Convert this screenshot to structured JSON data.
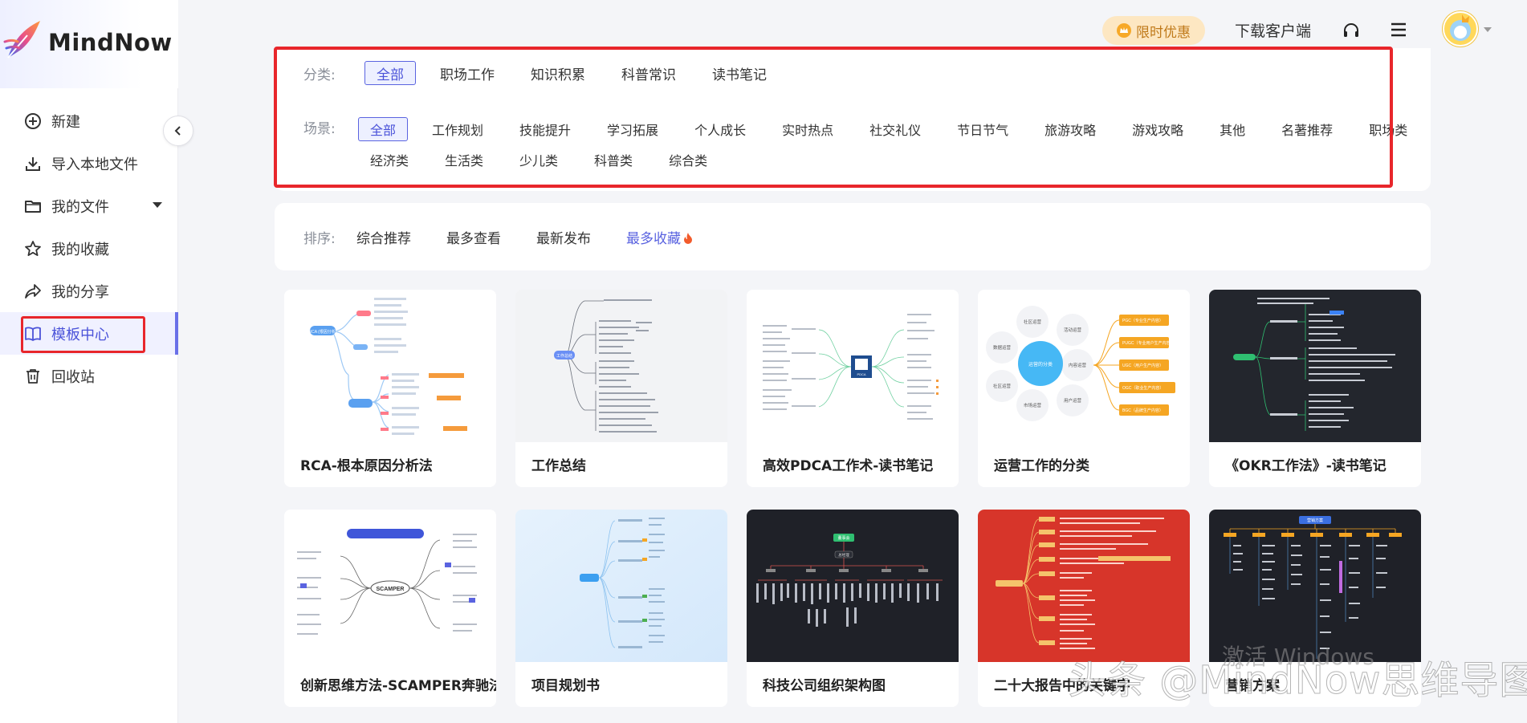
{
  "brand": {
    "name": "MindNow"
  },
  "sidebar": {
    "items": [
      {
        "label": "新建",
        "icon": "plus-circle-icon"
      },
      {
        "label": "导入本地文件",
        "icon": "import-icon"
      },
      {
        "label": "我的文件",
        "icon": "folder-icon"
      },
      {
        "label": "我的收藏",
        "icon": "star-icon"
      },
      {
        "label": "我的分享",
        "icon": "share-icon"
      },
      {
        "label": "模板中心",
        "icon": "book-icon",
        "active": true
      },
      {
        "label": "回收站",
        "icon": "trash-icon"
      }
    ]
  },
  "header": {
    "promo": "限时优惠",
    "download": "下载客户端"
  },
  "filters": {
    "category_label": "分类:",
    "categories": [
      "全部",
      "职场工作",
      "知识积累",
      "科普常识",
      "读书笔记"
    ],
    "category_selected": "全部",
    "scene_label": "场景:",
    "scenes": [
      "全部",
      "工作规划",
      "技能提升",
      "学习拓展",
      "个人成长",
      "实时热点",
      "社交礼仪",
      "节日节气",
      "旅游攻略",
      "游戏攻略",
      "其他",
      "名著推荐",
      "职场类",
      "经济类",
      "生活类",
      "少儿类",
      "科普类",
      "综合类"
    ],
    "scene_selected": "全部"
  },
  "sort": {
    "label": "排序:",
    "options": [
      "综合推荐",
      "最多查看",
      "最新发布",
      "最多收藏"
    ],
    "selected": "最多收藏"
  },
  "templates": [
    {
      "title": "RCA-根本原因分析法",
      "theme": "light"
    },
    {
      "title": "工作总结",
      "theme": "gray"
    },
    {
      "title": "高效PDCA工作术-读书笔记",
      "theme": "light"
    },
    {
      "title": "运营工作的分类",
      "theme": "light"
    },
    {
      "title": "《OKR工作法》-读书笔记",
      "theme": "dark"
    },
    {
      "title": "创新思维方法-SCAMPER奔驰法",
      "theme": "light"
    },
    {
      "title": "项目规划书",
      "theme": "blue"
    },
    {
      "title": "科技公司组织架构图",
      "theme": "dark"
    },
    {
      "title": "二十大报告中的关键字",
      "theme": "red"
    },
    {
      "title": "营销方案",
      "theme": "dark"
    }
  ],
  "thumb_text": {
    "rca_root": "RCA (根因分析)",
    "summary_root": "工作总结",
    "pdca_center": "PDCA",
    "ops_center": "运营的分类",
    "ops_nodes": [
      "社区运营",
      "活动运营",
      "数据运营",
      "内容运营",
      "社区运营",
      "市场运营",
      "用户运营"
    ],
    "ops_tags": [
      "PGC（专业生产内容）",
      "PUGC（专业用户生产内容）",
      "UGC（用户生产内容）",
      "OGC（职业生产内容）",
      "BGC（品牌生产内容）"
    ],
    "scamper_center": "SCAMPER",
    "org_top": "董事会",
    "org_ceo": "总经理",
    "marketing_top": "营销方案"
  },
  "watermark": "头条 @MindNow思维导图",
  "activate": "激活 Windows",
  "colors": {
    "accent": "#5a63e0",
    "highlight": "#e8262b",
    "promo_bg": "#fde7c2"
  }
}
